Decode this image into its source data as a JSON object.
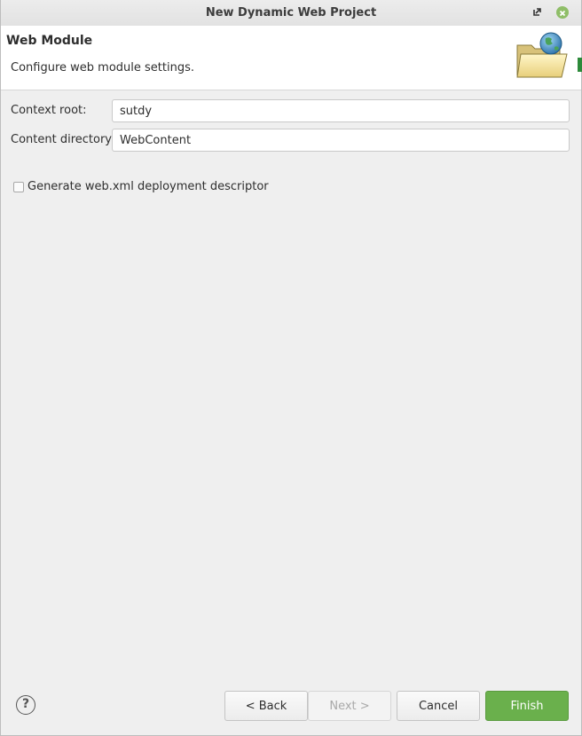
{
  "window": {
    "title": "New Dynamic Web Project"
  },
  "header": {
    "title": "Web Module",
    "description": "Configure web module settings."
  },
  "form": {
    "context_root": {
      "label": "Context root:",
      "value": "sutdy"
    },
    "content_directory": {
      "label": "Content directory:",
      "value": "WebContent"
    },
    "generate_web_xml": {
      "label": "Generate web.xml deployment descriptor",
      "checked": false
    }
  },
  "buttons": {
    "help": "?",
    "back": "< Back",
    "next": "Next >",
    "cancel": "Cancel",
    "finish": "Finish"
  },
  "colors": {
    "finish": "#6ab04c",
    "close": "#8fbe68"
  }
}
